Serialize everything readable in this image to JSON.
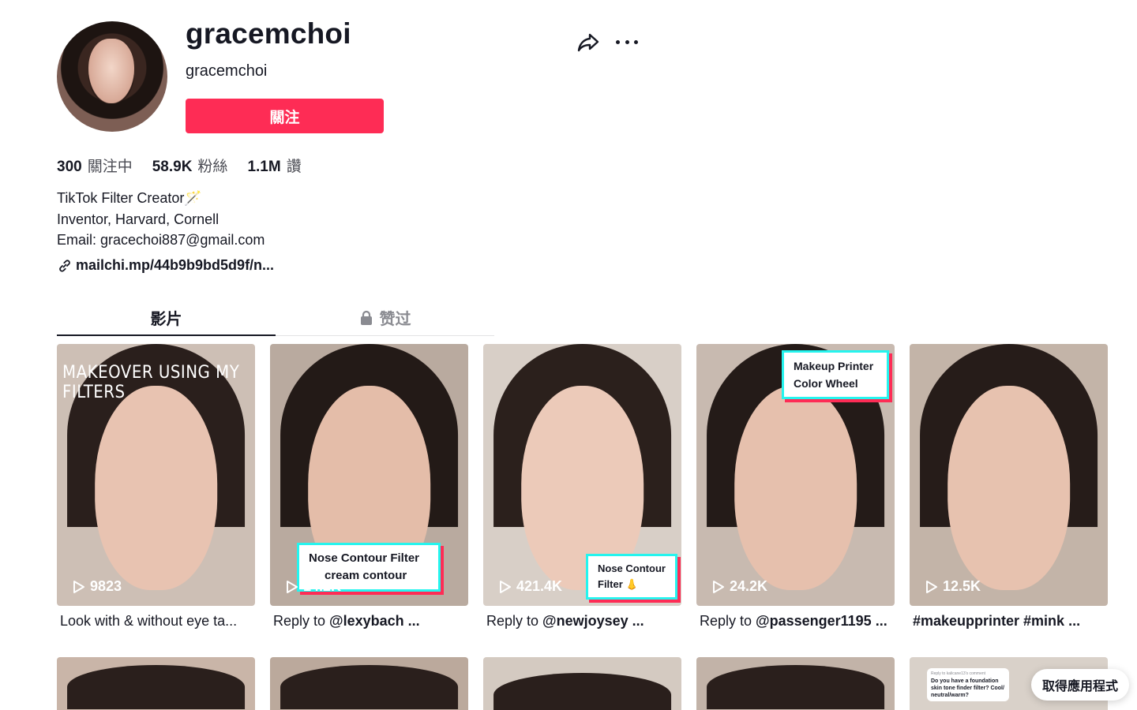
{
  "profile": {
    "unique_id": "gracemchoi",
    "nickname": "gracemchoi",
    "follow_label": "關注",
    "stats": [
      {
        "value": "300",
        "label": "關注中"
      },
      {
        "value": "58.9K",
        "label": "粉絲"
      },
      {
        "value": "1.1M",
        "label": "讚"
      }
    ],
    "bio": [
      "TikTok Filter Creator🪄",
      "Inventor, Harvard, Cornell",
      "Email: gracechoi887@gmail.com"
    ],
    "link": "mailchi.mp/44b9b9bd5d9f/n..."
  },
  "tabs": [
    {
      "label": "影片",
      "active": true
    },
    {
      "label": "赞过",
      "active": false,
      "icon": "lock-icon"
    }
  ],
  "videos": [
    {
      "views": "9823",
      "desc": "Look with & without eye ta...",
      "overlay": "MAKEOVER USING MY FILTERS",
      "bg": "#c9b8ad"
    },
    {
      "views": "14.2K",
      "desc_prefix": "Reply to ",
      "desc_bold": "@lexybach ...",
      "caption": [
        "Nose Contour Filter",
        "cream contour"
      ],
      "bg": "#bfb0a6"
    },
    {
      "views": "421.4K",
      "desc_prefix": "Reply to ",
      "desc_bold": "@newjoysey ...",
      "caption": [
        "Nose Contour",
        "Filter 👃"
      ],
      "bg": "#d7cdc4"
    },
    {
      "views": "24.2K",
      "desc_prefix": "Reply to ",
      "desc_bold": "@passenger1195 ...",
      "caption": [
        "Makeup Printer",
        "Color Wheel"
      ],
      "bg": "#cbbdb3"
    },
    {
      "views": "12.5K",
      "desc_bold": "#makeupprinter #mink ...",
      "bg": "#c6b7ab"
    }
  ],
  "row2_colors": [
    "#c9b5a8",
    "#bba99c",
    "#d4cac1",
    "#c2b3a8",
    "#d9d1c9"
  ],
  "row2_caption": {
    "header": "Reply to kalicane13's comment",
    "text": "Do you have a foundation skin tone finder filter? Cool/ neutral/warm?"
  },
  "get_app_label": "取得應用程式"
}
